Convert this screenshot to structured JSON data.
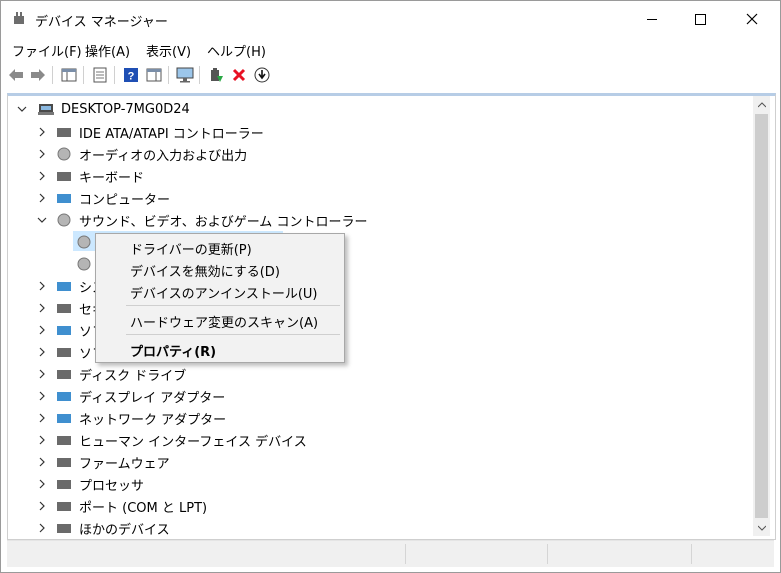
{
  "window": {
    "title": "デバイス マネージャー"
  },
  "menu": [
    "ファイル(F)",
    "操作(A)",
    "表示(V)",
    "ヘルプ(H)"
  ],
  "tree": {
    "root": "DESKTOP-7MG0D24",
    "categories": [
      "IDE ATA/ATAPI コントローラー",
      "オーディオの入力および出力",
      "キーボード",
      "コンピューター",
      "サウンド、ビデオ、およびゲーム コントローラー",
      "",
      "",
      "シス",
      "セキ",
      "ソフ",
      "ソフ",
      "ディスク ドライブ",
      "ディスプレイ アダプター",
      "ネットワーク アダプター",
      "ヒューマン インターフェイス デバイス",
      "ファームウェア",
      "プロセッサ",
      "ポート (COM と LPT)",
      "ほかのデバイス"
    ]
  },
  "context_menu": {
    "update_driver": "ドライバーの更新(P)",
    "disable_device": "デバイスを無効にする(D)",
    "uninstall_device": "デバイスのアンインストール(U)",
    "scan_hardware": "ハードウェア変更のスキャン(A)",
    "properties": "プロパティ(R)"
  },
  "colors": {
    "selection": "#cce8ff",
    "panel_top_border": "#b7cde6",
    "delete_red": "#e81123",
    "help_blue": "#1f4fb4"
  }
}
